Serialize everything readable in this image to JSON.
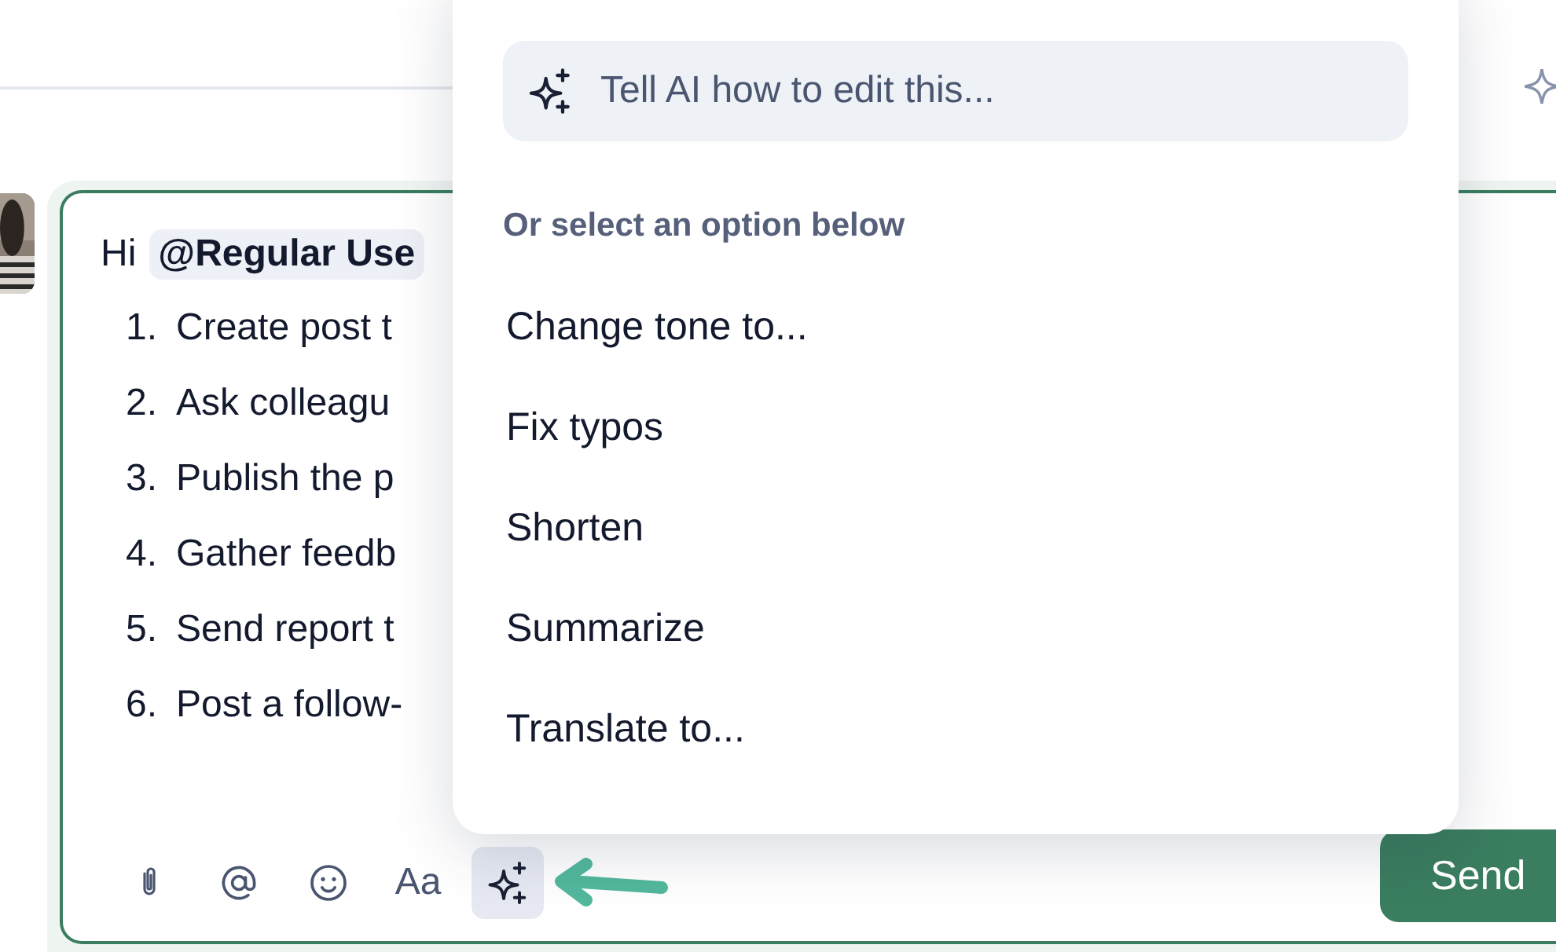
{
  "composer": {
    "greeting": "Hi",
    "mention": "@Regular Use",
    "list_items": [
      {
        "number": "1.",
        "text": "Create post t"
      },
      {
        "number": "2.",
        "text": "Ask colleagu"
      },
      {
        "number": "3.",
        "text": "Publish the p"
      },
      {
        "number": "4.",
        "text": "Gather feedb"
      },
      {
        "number": "5.",
        "text": "Send report t"
      },
      {
        "number": "6.",
        "text": "Post a follow-"
      }
    ],
    "toolbar": [
      {
        "kind": "attach",
        "selected": false
      },
      {
        "kind": "mention",
        "selected": false
      },
      {
        "kind": "emoji",
        "selected": false
      },
      {
        "kind": "format",
        "label": "Aa",
        "selected": false
      },
      {
        "kind": "ai",
        "selected": true
      }
    ],
    "send_button": "Send"
  },
  "ai_menu": {
    "placeholder": "Tell AI how to edit this...",
    "section_label": "Or select an option below",
    "options": [
      "Change tone to...",
      "Fix typos",
      "Shorten",
      "Summarize",
      "Translate to..."
    ]
  }
}
